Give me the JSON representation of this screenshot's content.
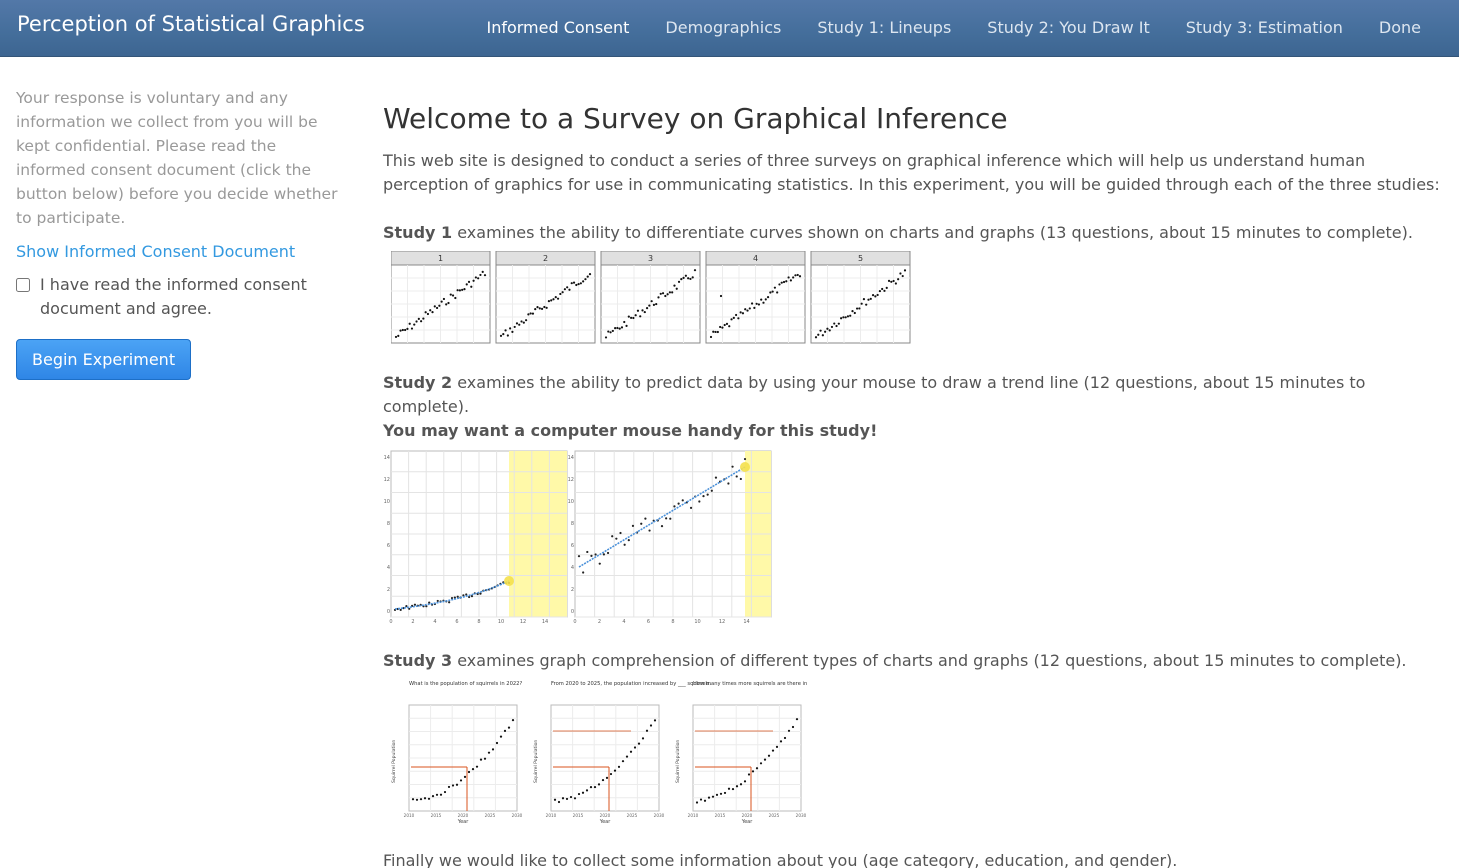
{
  "nav": {
    "brand": "Perception of Statistical Graphics",
    "items": [
      {
        "label": "Informed Consent",
        "active": true
      },
      {
        "label": "Demographics",
        "active": false
      },
      {
        "label": "Study 1: Lineups",
        "active": false
      },
      {
        "label": "Study 2: You Draw It",
        "active": false
      },
      {
        "label": "Study 3: Estimation",
        "active": false
      },
      {
        "label": "Done",
        "active": false
      }
    ]
  },
  "sidebar": {
    "intro": "Your response is voluntary and any information we collect from you will be kept confidential. Please read the informed consent document (click the button below) before you decide whether to participate.",
    "link": "Show Informed Consent Document",
    "checkbox_label": "I have read the informed consent document and agree.",
    "checkbox_checked": false,
    "button": "Begin Experiment"
  },
  "main": {
    "title": "Welcome to a Survey on Graphical Inference",
    "intro": "This web site is designed to conduct a series of three surveys on graphical inference which will help us understand human perception of graphics for use in communicating statistics. In this experiment, you will be guided through each of the three studies:",
    "study1": {
      "label": "Study 1",
      "text": " examines the ability to differentiate curves shown on charts and graphs (13 questions, about 15 minutes to complete).",
      "panels": [
        "1",
        "2",
        "3",
        "4",
        "5"
      ]
    },
    "study2": {
      "label": "Study 2",
      "text": " examines the ability to predict data by using your mouse to draw a trend line (12 questions, about 15 minutes to complete).",
      "note": "You may want a computer mouse handy for this study!"
    },
    "study3": {
      "label": "Study 3",
      "text": " examines graph comprehension of different types of charts and graphs (12 questions, about 15 minutes to complete).",
      "questions": [
        "What is the population of squirrels in 2022?",
        "From 2020 to 2025, the population increased by ___ squirrels.",
        "How many times more squirrels are there in 2023 than in 2016?"
      ]
    },
    "outro": "Finally we would like to collect some information about you (age category, education, and gender)."
  },
  "colors": {
    "navbar": "#446e9b",
    "link": "#3399e0",
    "button": "#2f86e6",
    "highlight": "#fff9a8",
    "trend": "#4a90d9",
    "annotation": "#d9531e"
  }
}
